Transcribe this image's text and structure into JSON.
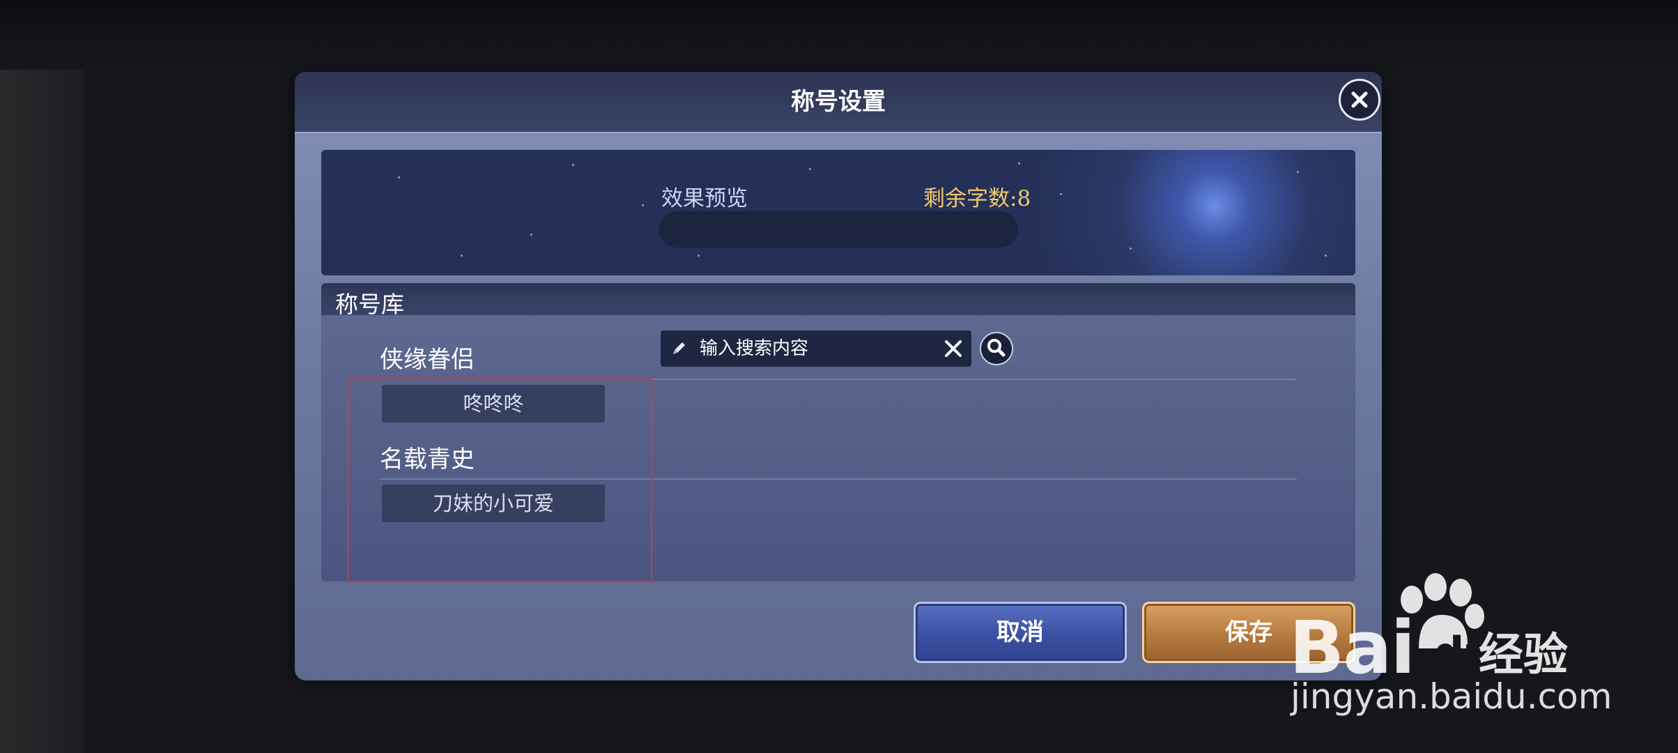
{
  "dialog": {
    "title": "称号设置",
    "close_icon": "close-icon"
  },
  "preview": {
    "label": "效果预览",
    "remaining": "剩余字数:8",
    "value": ""
  },
  "library": {
    "title": "称号库",
    "search": {
      "placeholder": "输入搜索内容",
      "value": "",
      "pen_icon": "pen-icon",
      "clear_icon": "clear-icon",
      "search_icon": "search-icon"
    },
    "categories": [
      {
        "title": "侠缘眷侣",
        "items": [
          "咚咚咚"
        ]
      },
      {
        "title": "名载青史",
        "items": [
          "刀妹的小可爱"
        ]
      }
    ]
  },
  "buttons": {
    "cancel": "取消",
    "save": "保存"
  },
  "watermark": {
    "logo": "Bai",
    "logo_du": "du",
    "cn": "经验",
    "url": "jingyan.baidu.com"
  },
  "colors": {
    "highlight": "#e0323a",
    "remaining": "#f1c770",
    "cancel": "#3d52a3",
    "save": "#b57a3f"
  }
}
